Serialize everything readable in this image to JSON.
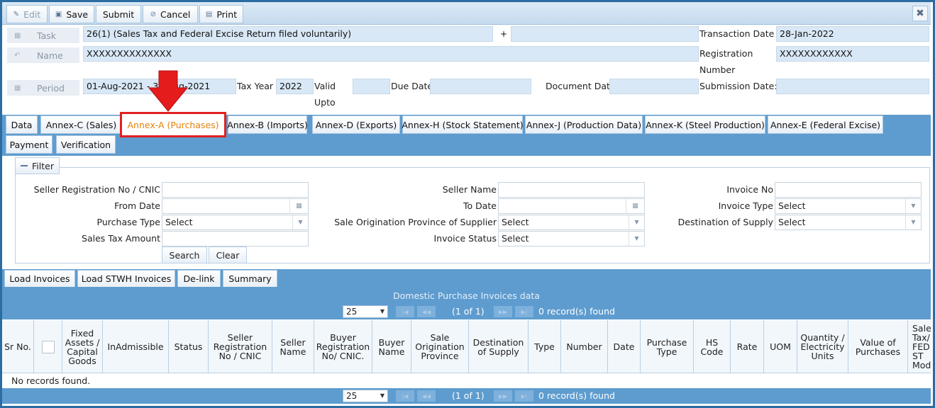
{
  "toolbar": {
    "edit": "Edit",
    "save": "Save",
    "submit": "Submit",
    "cancel": "Cancel",
    "print": "Print",
    "close": "✖"
  },
  "header": {
    "task_label": "Task",
    "task_value": "26(1) (Sales Tax and Federal Excise Return filed voluntarily)",
    "plus": "+",
    "name_label": "Name",
    "name_value": "XXXXXXXXXXXXXX",
    "transaction_date_label": "Transaction Date",
    "transaction_date_value": "28-Jan-2022",
    "registration_label_1": "Registration",
    "registration_label_2": "Number",
    "registration_value": "XXXXXXXXXXXX",
    "period_label": "Period",
    "period_value": "01-Aug-2021 -  31-Aug-2021",
    "tax_year_label": "Tax Year",
    "tax_year_value": "2022",
    "valid_label_1": "Valid",
    "valid_label_2": "Upto",
    "due_date_label": "Due Date",
    "document_date_label": "Document Date",
    "submission_date_label": "Submission Date: *"
  },
  "tabs_row1": [
    "Data",
    "Annex-C (Sales)",
    "Annex-A (Purchases)",
    "Annex-B (Imports)",
    "Annex-D (Exports)",
    "Annex-H (Stock Statement)",
    "Annex-J (Production Data)",
    "Annex-K (Steel Production)",
    "Annex-E (Federal Excise)"
  ],
  "tabs_row2": [
    "Payment",
    "Verification"
  ],
  "filter": {
    "legend": "Filter",
    "seller_reg_label": "Seller Registration No / CNIC",
    "seller_name_label": "Seller Name",
    "invoice_no_label": "Invoice No",
    "from_date_label": "From Date",
    "to_date_label": "To Date",
    "invoice_type_label": "Invoice Type",
    "invoice_type_value": "Select",
    "purchase_type_label": "Purchase Type",
    "purchase_type_value": "Select",
    "origin_province_label": "Sale Origination Province of Supplier",
    "origin_province_value": "Select",
    "destination_label": "Destination of Supply",
    "destination_value": "Select",
    "sales_tax_label": "Sales Tax Amount",
    "invoice_status_label": "Invoice Status",
    "invoice_status_value": "Select",
    "search": "Search",
    "clear": "Clear"
  },
  "actions": [
    "Load Invoices",
    "Load STWH Invoices",
    "De-link",
    "Summary"
  ],
  "grid": {
    "caption": "Domestic Purchase Invoices data",
    "page_size": "25",
    "page_info": "(1 of 1)",
    "record_count": "0 record(s) found",
    "no_records": "No records found.",
    "columns": [
      "Sr No.",
      "",
      "Fixed Assets / Capital Goods",
      "InAdmissible",
      "Status",
      "Seller Registration No / CNIC",
      "Seller Name",
      "Buyer Registration No/ CNIC.",
      "Buyer Name",
      "Sale Origination Province",
      "Destination of Supply",
      "Type",
      "Number",
      "Date",
      "Purchase Type",
      "HS Code",
      "Rate",
      "UOM",
      "Quantity / Electricity Units",
      "Value of Purchases",
      "Sales Tax/ FED in ST Mode"
    ]
  }
}
